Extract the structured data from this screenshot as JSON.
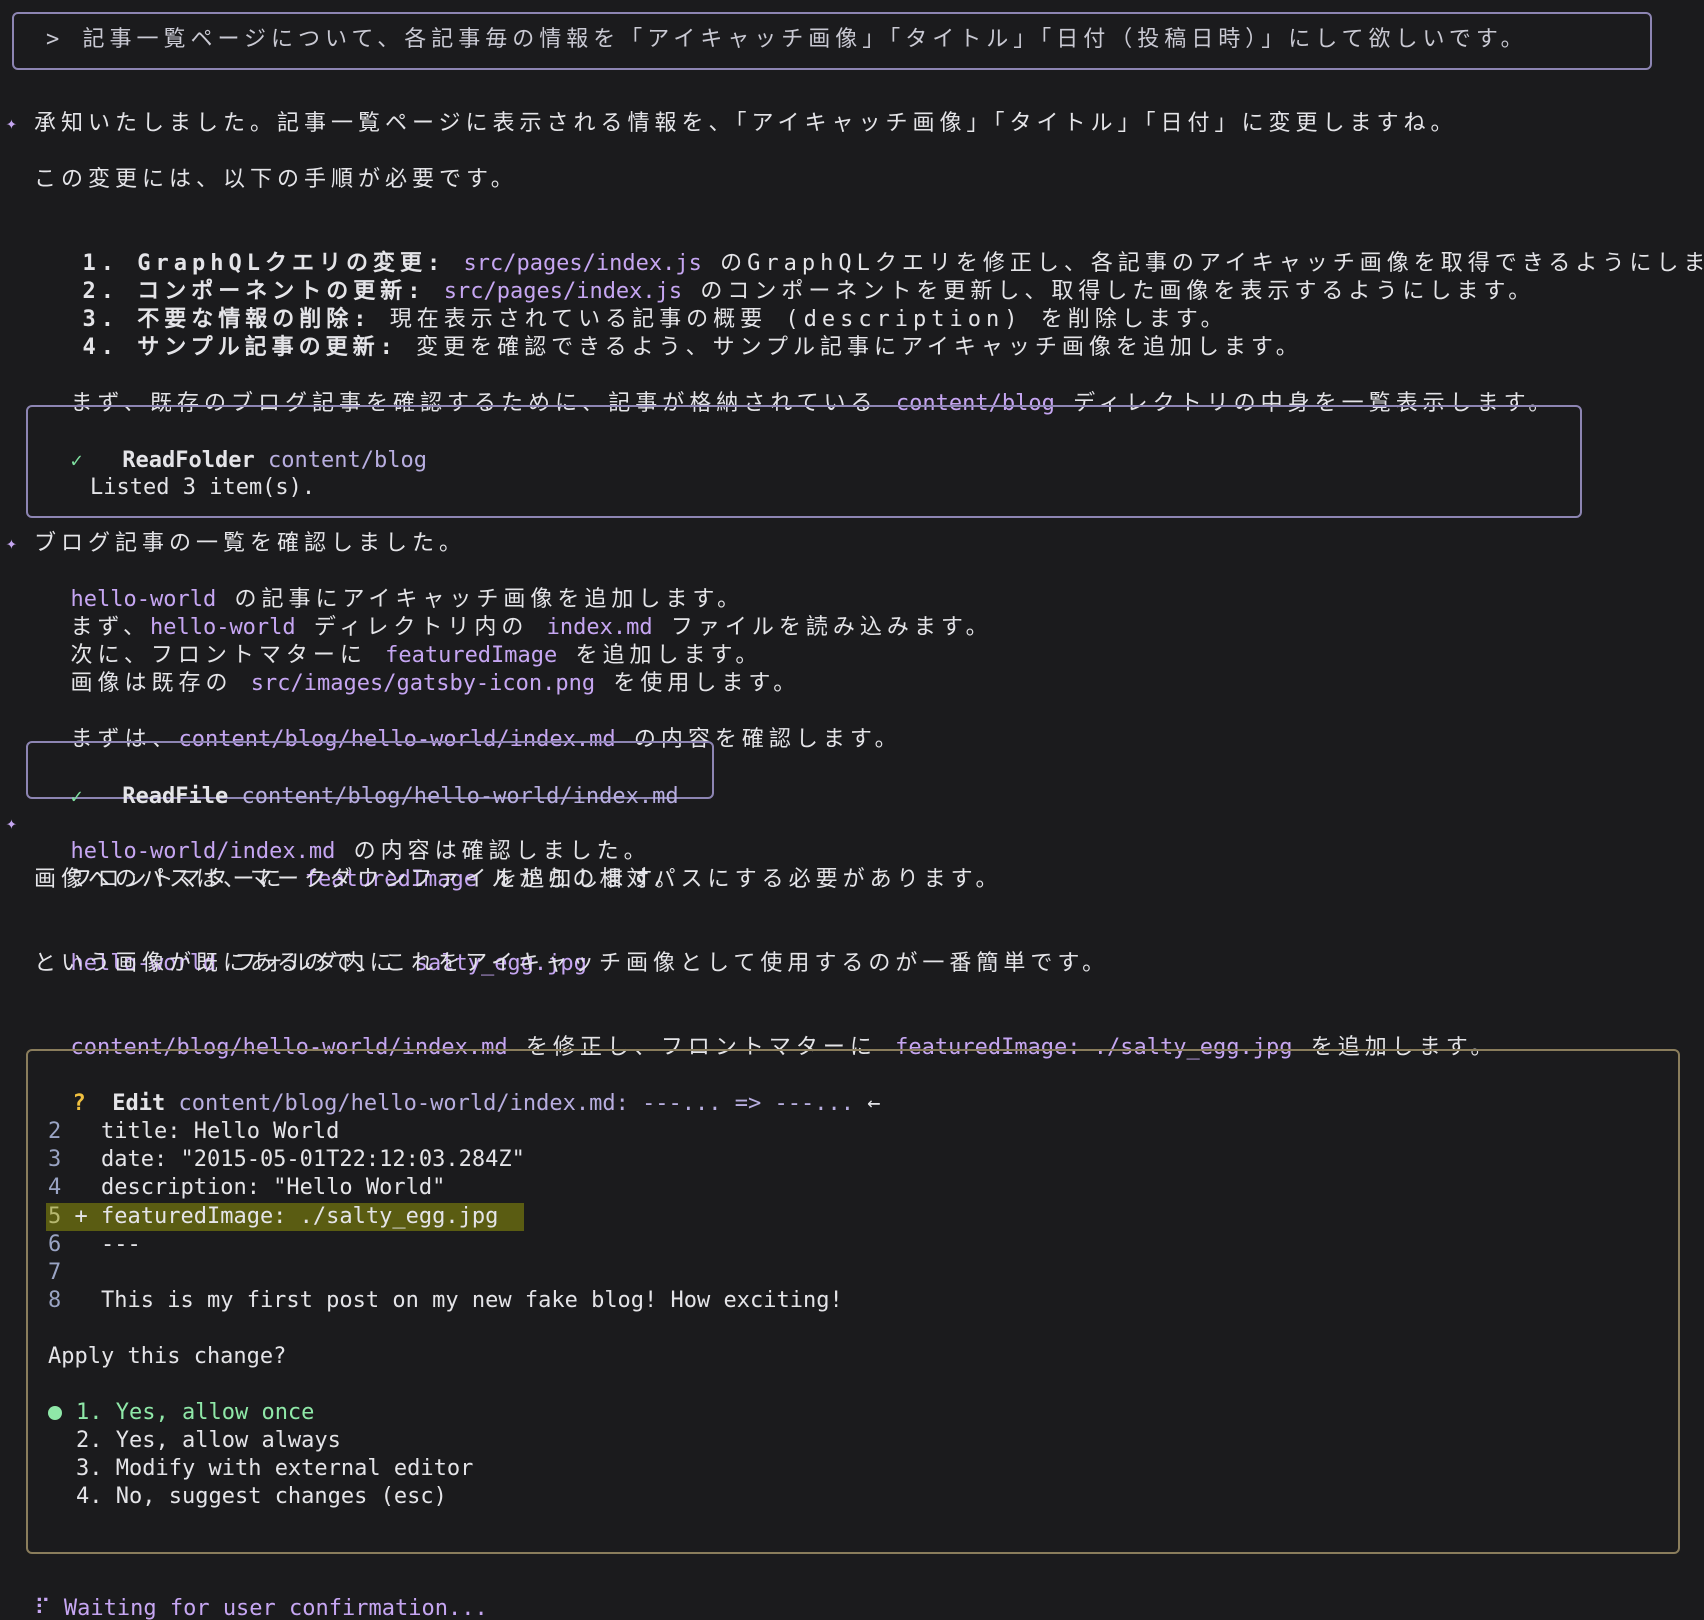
{
  "prompt": {
    "text": "> 記事一覧ページについて、各記事毎の情報を「アイキャッチ画像」「タイトル」「日付（投稿日時）」にして欲しいです。"
  },
  "response1": {
    "intro": "承知いたしました。記事一覧ページに表示される情報を、「アイキャッチ画像」「タイトル」「日付」に変更しますね。",
    "steps_intro": "この変更には、以下の手順が必要です。",
    "steps": [
      {
        "num": "1.",
        "title": "GraphQLクエリの変更:",
        "code": "src/pages/index.js",
        "rest": "のGraphQLクエリを修正し、各記事のアイキャッチ画像を取得できるようにします。"
      },
      {
        "num": "2.",
        "title": "コンポーネントの更新:",
        "code": "src/pages/index.js",
        "rest": "のコンポーネントを更新し、取得した画像を表示するようにします。"
      },
      {
        "num": "3.",
        "title": "不要な情報の削除:",
        "code": "",
        "rest": "現在表示されている記事の概要 (description) を削除します。"
      },
      {
        "num": "4.",
        "title": "サンプル記事の更新:",
        "code": "",
        "rest": "変更を確認できるよう、サンプル記事にアイキャッチ画像を追加します。"
      }
    ],
    "next_pre": "まず、既存のブログ記事を確認するために、記事が格納されている",
    "next_code": "content/blog",
    "next_post": "ディレクトリの中身を一覧表示します。"
  },
  "tool1": {
    "name": "ReadFolder",
    "arg": "content/blog",
    "result": "Listed 3 item(s)."
  },
  "response2": {
    "l1": "ブログ記事の一覧を確認しました。",
    "l2_code": "hello-world",
    "l2_rest": "の記事にアイキャッチ画像を追加します。",
    "l3_pre": "まず、",
    "l3_code1": "hello-world",
    "l3_mid": "ディレクトリ内の",
    "l3_code2": "index.md",
    "l3_post": "ファイルを読み込みます。",
    "l4_pre": "次に、フロントマターに",
    "l4_code": "featuredImage",
    "l4_post": "を追加します。",
    "l5_pre": "画像は既存の",
    "l5_code": "src/images/gatsby-icon.png",
    "l5_post": "を使用します。",
    "l6_pre": "まずは、",
    "l6_code": "content/blog/hello-world/index.md",
    "l6_post": "の内容を確認します。"
  },
  "tool2": {
    "name": "ReadFile",
    "arg": "content/blog/hello-world/index.md"
  },
  "response3": {
    "l1_code": "hello-world/index.md",
    "l1_rest": "の内容は確認しました。",
    "l2_pre": "フロントマターに",
    "l2_code": "featuredImage",
    "l2_post": "を追加します。",
    "l3": "画像へのパスは、マークダウンファイルからの相対パスにする必要があります。",
    "l4_code1": "hello-world",
    "l4_mid": "フォルダ内に",
    "l4_code2": "salty_egg.jpg",
    "l5": "という画像が既にあるので、これをアイキャッチ画像として使用するのが一番簡単です。",
    "l6_code1": "content/blog/hello-world/index.md",
    "l6_mid": "を修正し、フロントマターに",
    "l6_code2": "featuredImage: ./salty_egg.jpg",
    "l6_post": "を追加します。"
  },
  "edit": {
    "marker": "?",
    "name": "Edit",
    "arg": "content/blog/hello-world/index.md: ---... => ---...",
    "arrow": "←",
    "diff": [
      {
        "num": "2",
        "sign": " ",
        "text": "title: Hello World"
      },
      {
        "num": "3",
        "sign": " ",
        "text": "date: \"2015-05-01T22:12:03.284Z\""
      },
      {
        "num": "4",
        "sign": " ",
        "text": "description: \"Hello World\""
      },
      {
        "num": "5",
        "sign": "+",
        "text": "featuredImage: ./salty_egg.jpg"
      },
      {
        "num": "6",
        "sign": " ",
        "text": "---"
      },
      {
        "num": "7",
        "sign": " ",
        "text": ""
      },
      {
        "num": "8",
        "sign": " ",
        "text": "This is my first post on my new fake blog! How exciting!"
      }
    ],
    "question": "Apply this change?",
    "options": [
      {
        "num": "1.",
        "label": "Yes, allow once"
      },
      {
        "num": "2.",
        "label": "Yes, allow always"
      },
      {
        "num": "3.",
        "label": "Modify with external editor"
      },
      {
        "num": "4.",
        "label": "No, suggest changes (esc)"
      }
    ]
  },
  "status": {
    "spinner": "⠏",
    "text": "Waiting for user confirmation..."
  },
  "colors": {
    "background": "#1b1b1d",
    "accent_purple": "#c6a6f2",
    "border_purple": "#8d85b3",
    "border_edit": "#8a7d5c",
    "success_green": "#8fe8a8",
    "warning_yellow": "#f0c040",
    "diff_add_bg": "#5a5c12"
  }
}
